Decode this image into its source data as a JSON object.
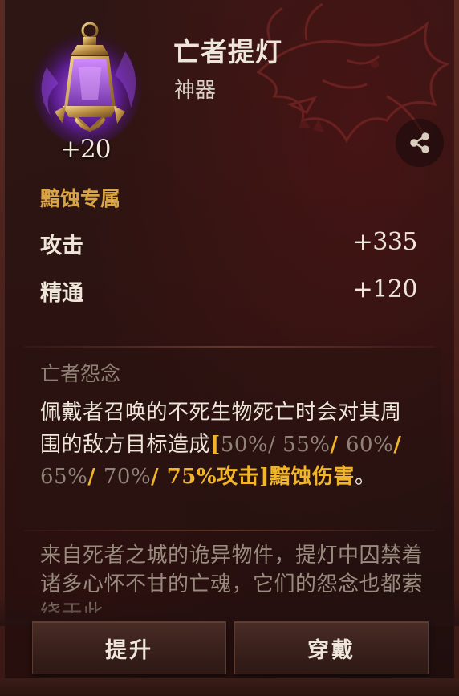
{
  "item": {
    "name": "亡者提灯",
    "category": "神器",
    "level": "+20",
    "icon": "lantern-icon"
  },
  "exclusive_label": "黯蚀专属",
  "stats": [
    {
      "name": "攻击",
      "value": "+335"
    },
    {
      "name": "精通",
      "value": "+120"
    }
  ],
  "effect": {
    "title": "亡者怨念",
    "text_main": "佩戴者召唤的不死生物死亡时会对其周围的敌方目标造成",
    "bracket_open": "[",
    "tier1": "50%/",
    "tier2": "55%",
    "tier3": "60%",
    "tier4": "65%",
    "tier5": "70%",
    "sep": "/ ",
    "tier_active": "75%攻击",
    "bracket_close": "]",
    "damage_type": "黯蚀伤害",
    "end": "。"
  },
  "lore": {
    "text": "来自死者之城的诡异物件，提灯中囚禁着诸多心怀不甘的亡魂，它们的怨念也都萦绕于此。"
  },
  "buttons": {
    "upgrade": "提升",
    "equip": "穿戴"
  },
  "colors": {
    "accent_gold": "#f2b52a",
    "exclusive": "#d9a441",
    "dim_text": "#8f8277",
    "main_text": "#efe6da"
  }
}
